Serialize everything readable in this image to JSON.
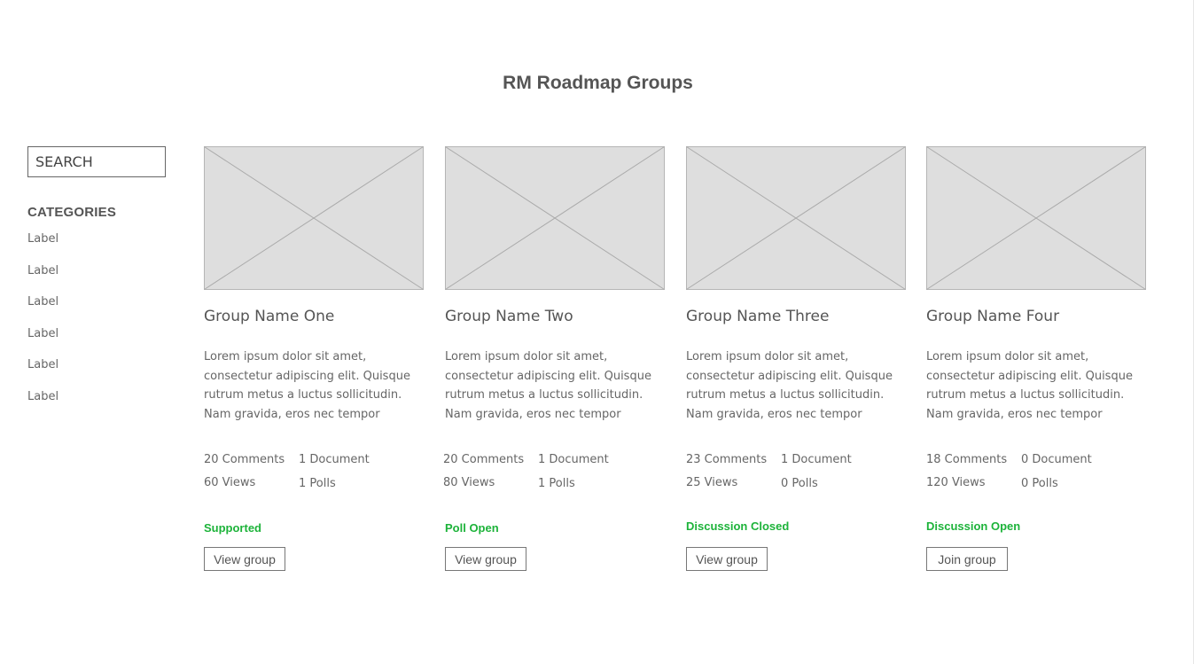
{
  "page": {
    "title": "RM Roadmap Groups"
  },
  "sidebar": {
    "search_placeholder": "SEARCH",
    "categories_title": "CATEGORIES",
    "categories": [
      "Label",
      "Label",
      "Label",
      "Label",
      "Label",
      "Label"
    ]
  },
  "colors": {
    "text": "#555555",
    "status_green": "#1db33a",
    "placeholder_fill": "#dedede",
    "placeholder_stroke": "#aaaaaa"
  },
  "groups": [
    {
      "name": "Group Name One",
      "description": "Lorem ipsum dolor sit amet, consectetur adipiscing elit. Quisque rutrum metus a luctus sollicitudin. Nam gravida, eros nec tempor",
      "comments": "20 Comments",
      "documents": "1 Document",
      "views": "60 Views",
      "polls": "1 Polls",
      "status": "Supported",
      "button_label": "View group"
    },
    {
      "name": "Group Name Two",
      "description": "Lorem ipsum dolor sit amet, consectetur adipiscing elit. Quisque rutrum metus a luctus sollicitudin. Nam gravida, eros nec tempor",
      "comments": "20 Comments",
      "documents": "1 Document",
      "views": "80 Views",
      "polls": "1 Polls",
      "status": "Poll Open",
      "button_label": "View group"
    },
    {
      "name": "Group Name Three",
      "description": "Lorem ipsum dolor sit amet, consectetur adipiscing elit. Quisque rutrum metus a luctus sollicitudin. Nam gravida, eros nec tempor",
      "comments": "23 Comments",
      "documents": "1 Document",
      "views": "25 Views",
      "polls": "0 Polls",
      "status": "Discussion Closed",
      "button_label": "View group"
    },
    {
      "name": "Group Name Four",
      "description": "Lorem ipsum dolor sit amet, consectetur adipiscing elit. Quisque rutrum metus a luctus sollicitudin. Nam gravida, eros nec tempor",
      "comments": "18 Comments",
      "documents": "0 Document",
      "views": "120 Views",
      "polls": "0 Polls",
      "status": "Discussion Open",
      "button_label": "Join group"
    }
  ]
}
